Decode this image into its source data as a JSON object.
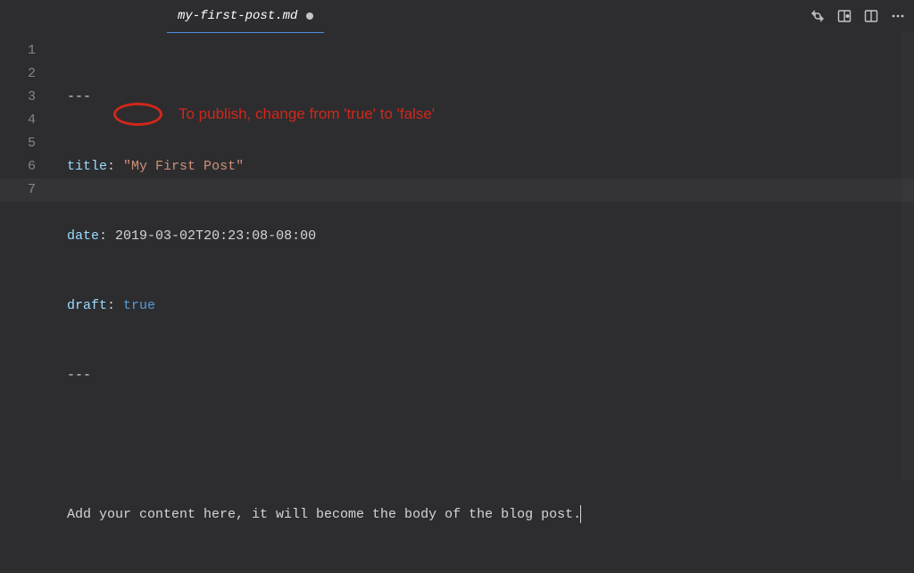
{
  "tab": {
    "filename": "my-first-post.md",
    "dirty": true
  },
  "editorActions": {
    "icon1": "compare-changes-icon",
    "icon2": "open-preview-icon",
    "icon3": "split-editor-icon",
    "icon4": "more-actions-icon"
  },
  "lines": {
    "l1": {
      "num": "1",
      "content": "---"
    },
    "l2": {
      "num": "2",
      "key": "title",
      "colon": ":",
      "value": "\"My First Post\""
    },
    "l3": {
      "num": "3",
      "key": "date",
      "colon": ":",
      "value": "2019-03-02T20:23:08-08:00"
    },
    "l4": {
      "num": "4",
      "key": "draft",
      "colon": ":",
      "value": "true"
    },
    "l5": {
      "num": "5",
      "content": "---"
    },
    "l6": {
      "num": "6",
      "content": ""
    },
    "l7": {
      "num": "7",
      "content": "Add your content here, it will become the body of the blog post."
    }
  },
  "annotation": {
    "text": "To publish, change from 'true' to 'false'"
  }
}
